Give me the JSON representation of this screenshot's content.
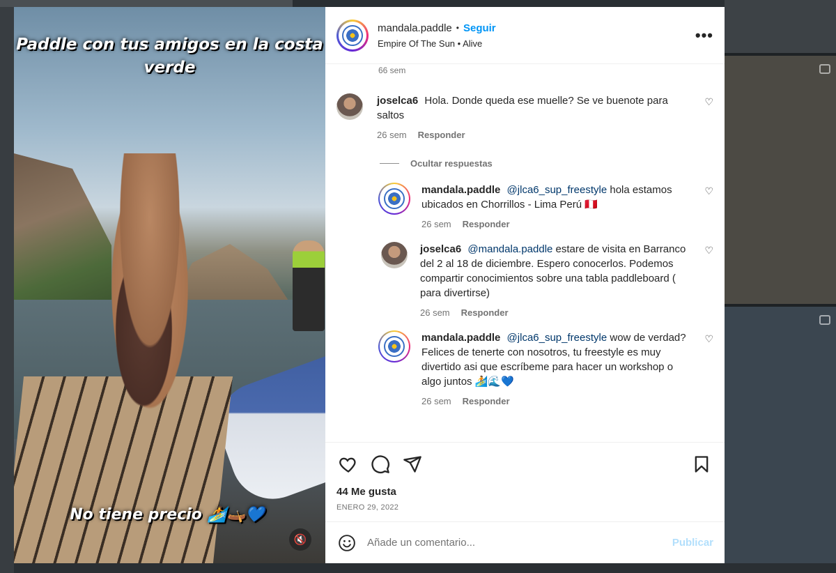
{
  "post": {
    "username": "mandala.paddle",
    "follow_label": "Seguir",
    "separator": "•",
    "audio": "Empire Of The Sun • Alive",
    "more_label": "•••",
    "caption_top": "Paddle con tus amigos en la costa verde",
    "caption_bottom": "No tiene precio 🏄🛶💙",
    "mute_icon": "🔇"
  },
  "comments": {
    "previous_time": "66 sem",
    "items": [
      {
        "user": "joselca6",
        "mention": "",
        "text": "Hola. Donde queda ese muelle? Se ve buenote para saltos",
        "time": "26 sem",
        "reply": "Responder"
      }
    ],
    "hide_replies": "Ocultar respuestas",
    "replies": [
      {
        "user": "mandala.paddle",
        "mention": "@jlca6_sup_freestyle",
        "text": "hola estamos ubicados en Chorrillos - Lima Perú 🇵🇪",
        "time": "26 sem",
        "reply": "Responder"
      },
      {
        "user": "joselca6",
        "mention": "@mandala.paddle",
        "text": "estare de visita en Barranco del 2 al 18 de diciembre. Espero conocerlos. Podemos compartir conocimientos sobre una tabla paddleboard ( para divertirse)",
        "time": "26 sem",
        "reply": "Responder"
      },
      {
        "user": "mandala.paddle",
        "mention": "@jlca6_sup_freestyle",
        "text": "wow de verdad? Felices de tenerte con nosotros, tu freestyle es muy divertido asi que escríbeme para hacer un workshop o algo juntos 🏄🌊💙",
        "time": "26 sem",
        "reply": "Responder"
      }
    ],
    "heart_icon": "♡"
  },
  "actions": {
    "likes": "44 Me gusta",
    "date": "ENERO 29, 2022"
  },
  "composer": {
    "placeholder": "Añade un comentario...",
    "publish": "Publicar"
  },
  "colors": {
    "accent": "#0095f6",
    "text": "#262626",
    "muted": "#737373",
    "publish_disabled": "#b2dffc"
  }
}
